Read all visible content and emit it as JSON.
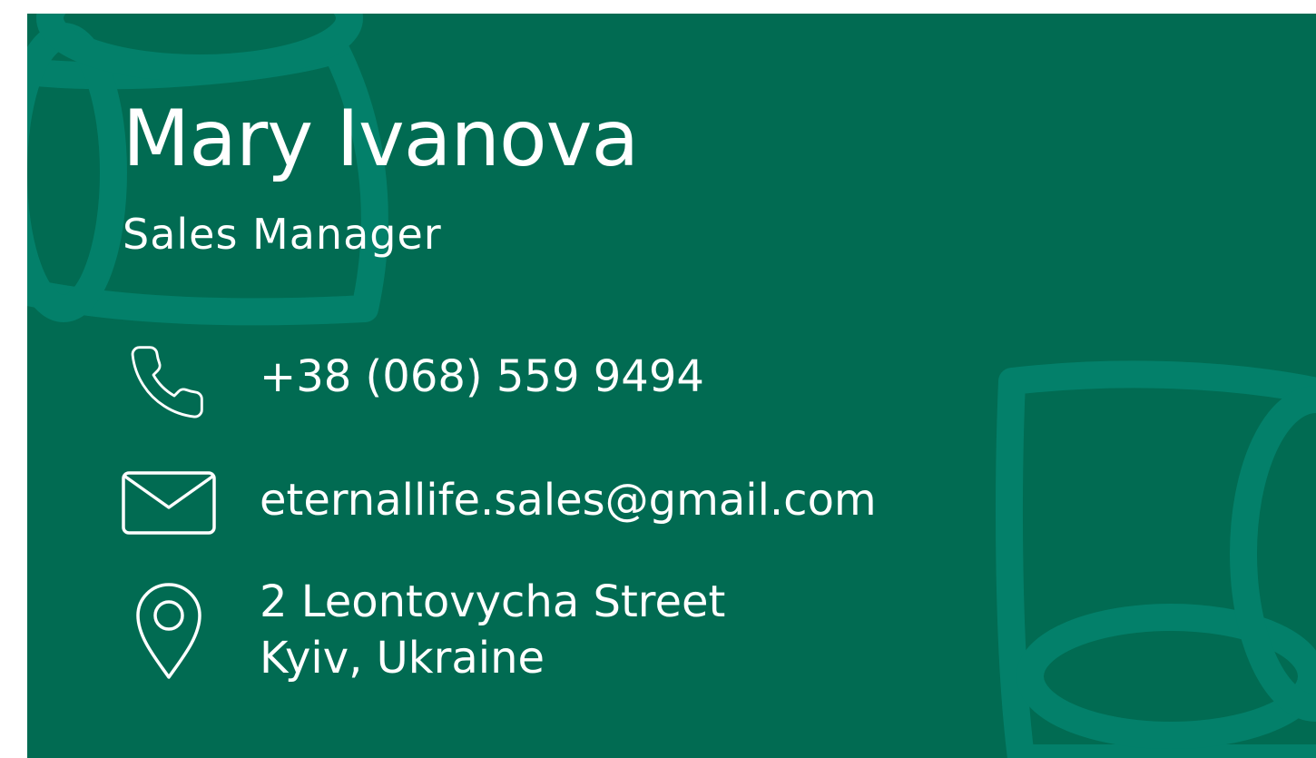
{
  "card": {
    "name": "Mary Ivanova",
    "role": "Sales Manager",
    "colors": {
      "background": "#016b52",
      "decoration": "#03806a",
      "text": "#ffffff"
    },
    "contacts": {
      "phone": {
        "icon": "phone-icon",
        "value": "+38 (068) 559 9494"
      },
      "email": {
        "icon": "envelope-icon",
        "value": "eternallife.sales@gmail.com"
      },
      "address": {
        "icon": "map-pin-icon",
        "line1": "2 Leontovycha Street",
        "line2": "Kyiv, Ukraine"
      }
    }
  }
}
